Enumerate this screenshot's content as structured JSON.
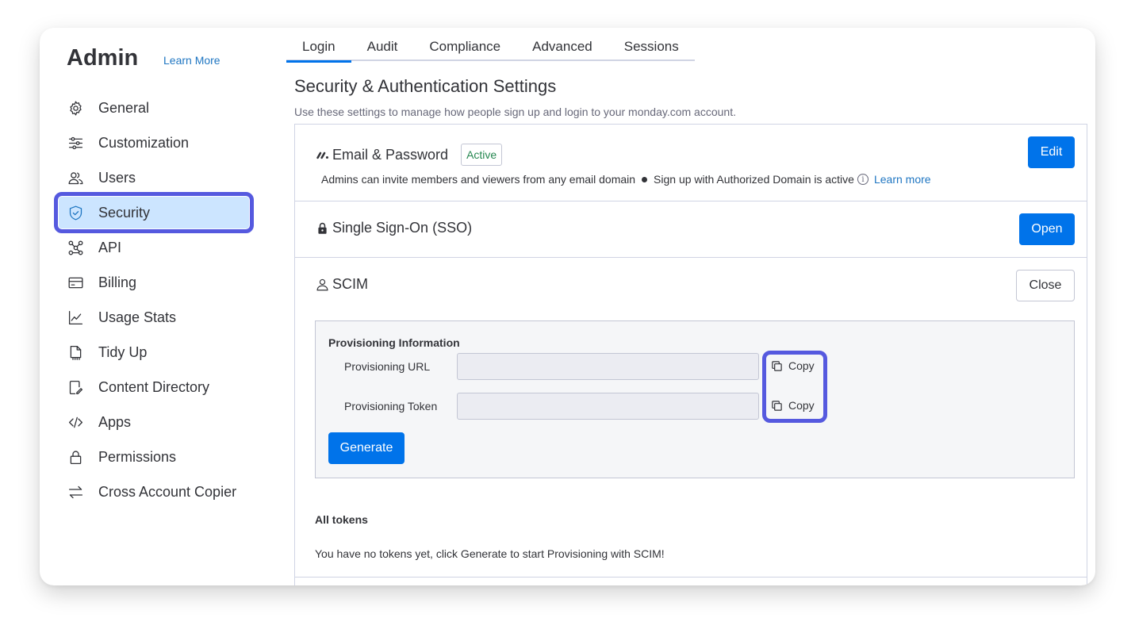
{
  "sidebar": {
    "title": "Admin",
    "learn_more": "Learn More",
    "items": [
      {
        "label": "General",
        "icon": "gear-icon"
      },
      {
        "label": "Customization",
        "icon": "sliders-icon"
      },
      {
        "label": "Users",
        "icon": "users-icon"
      },
      {
        "label": "Security",
        "icon": "shield-icon",
        "active": true
      },
      {
        "label": "API",
        "icon": "api-icon"
      },
      {
        "label": "Billing",
        "icon": "credit-card-icon"
      },
      {
        "label": "Usage Stats",
        "icon": "chart-line-icon"
      },
      {
        "label": "Tidy Up",
        "icon": "broom-icon"
      },
      {
        "label": "Content Directory",
        "icon": "document-edit-icon"
      },
      {
        "label": "Apps",
        "icon": "code-icon"
      },
      {
        "label": "Permissions",
        "icon": "lock-icon"
      },
      {
        "label": "Cross Account Copier",
        "icon": "transfer-arrows-icon"
      }
    ]
  },
  "tabs": [
    {
      "label": "Login",
      "active": true
    },
    {
      "label": "Audit"
    },
    {
      "label": "Compliance"
    },
    {
      "label": "Advanced"
    },
    {
      "label": "Sessions"
    }
  ],
  "main": {
    "title": "Security & Authentication Settings",
    "subtitle": "Use these settings to manage how people sign up and login to your monday.com account."
  },
  "email_password": {
    "title": "Email & Password",
    "badge": "Active",
    "desc_part1": "Admins can invite members and viewers from any email domain",
    "desc_part2": "Sign up with Authorized Domain is active",
    "learn_more": "Learn more",
    "button": "Edit"
  },
  "sso": {
    "title": "Single Sign-On (SSO)",
    "button": "Open"
  },
  "scim": {
    "title": "SCIM",
    "button": "Close",
    "provisioning": {
      "heading": "Provisioning Information",
      "url_label": "Provisioning URL",
      "url_value": "",
      "token_label": "Provisioning Token",
      "token_value": "",
      "copy_label": "Copy",
      "generate_button": "Generate"
    },
    "tokens_heading": "All tokens",
    "tokens_empty": "You have no tokens yet, click Generate to start Provisioning with SCIM!"
  },
  "colors": {
    "accent": "#0073ea",
    "active_nav_bg": "#cce5ff",
    "highlight_outline": "#5559df",
    "badge_green": "#258750"
  }
}
